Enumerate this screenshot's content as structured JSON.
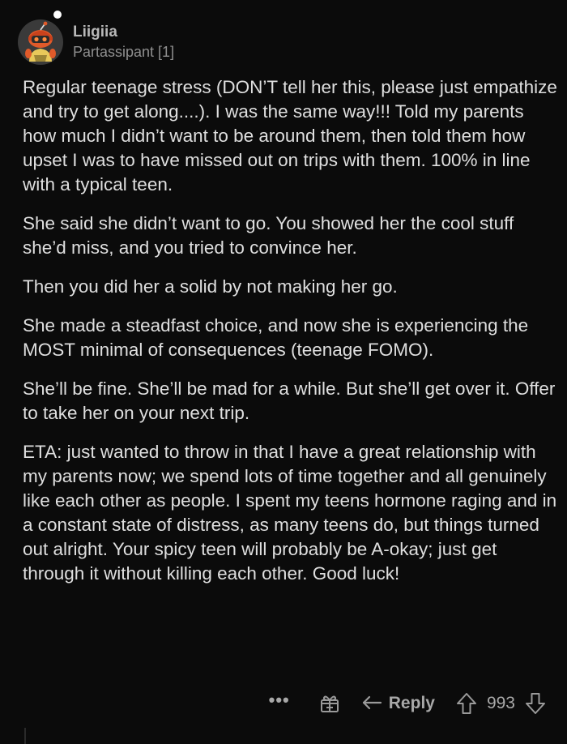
{
  "comment": {
    "author": "Liigiia",
    "flair": "Partassipant [1]",
    "paragraphs": [
      "Regular teenage stress (DON’T tell her this, please just empathize and try to get along....). I was the same way!!! Told my parents how much I didn’t want to be around them, then told them how upset I was to have missed out on trips with them. 100% in line with a typical teen.",
      "She said she didn’t want to go. You showed her the cool stuff she’d miss, and you tried to convince her.",
      "Then you did her a solid by not making her go.",
      "She made a steadfast choice, and now she is experiencing the MOST minimal of consequences (teenage FOMO).",
      "She’ll be fine. She’ll be mad for a while. But she’ll get over it. Offer to take her on your next trip.",
      "ETA: just wanted to throw in that I have a great relationship with my parents now; we spend lots of time together and all genuinely like each other as people. I spent my teens hormone raging and in a constant state of distress, as many teens do, but things turned out alright. Your spicy teen will probably be A-okay; just get through it without killing each other. Good luck!"
    ]
  },
  "actions": {
    "more_label": "•••",
    "award_icon": "gift-icon",
    "reply_icon": "reply-arrow-icon",
    "reply_label": "Reply",
    "upvote_icon": "upvote-arrow-icon",
    "score": "993",
    "downvote_icon": "downvote-arrow-icon"
  }
}
